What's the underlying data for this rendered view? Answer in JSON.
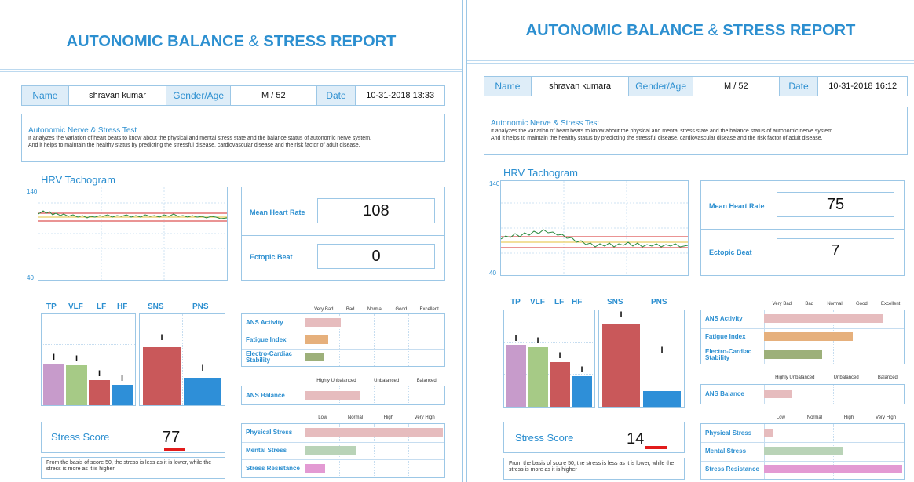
{
  "reports": [
    {
      "title_a": "AUTONOMIC BALANCE",
      "title_amp": "&",
      "title_b": "STRESS REPORT",
      "name_label": "Name",
      "name": "shravan kumar",
      "gender_label": "Gender/Age",
      "gender_age": "M / 52",
      "date_label": "Date",
      "date": "10-31-2018 13:33",
      "test_title": "Autonomic Nerve & Stress Test",
      "test_desc_1": "It analyzes the variation of heart beats to know about the physical and mental stress state and the balance status of autonomic nerve system.",
      "test_desc_2": "And it helps to maintain the healthy status by predicting the stressful disease, cardiovascular disease and the risk factor of adult disease.",
      "hrv_title": "HRV Tachogram",
      "hrv_max": "140",
      "hrv_min": "40",
      "mean_hr_label": "Mean Heart Rate",
      "mean_hr": "108",
      "ectopic_label": "Ectopic Beat",
      "ectopic": "0",
      "bar_labels": [
        "TP",
        "VLF",
        "LF",
        "HF",
        "SNS",
        "PNS"
      ],
      "bar_values": [
        0.46,
        0.44,
        0.28,
        0.22,
        0.64,
        0.3
      ],
      "scale1": [
        "Very Bad",
        "Bad",
        "Normal",
        "Good",
        "Excellent"
      ],
      "ans_activity_label": "ANS Activity",
      "fatigue_label": "Fatigue Index",
      "electro_label": "Electro-Cardiac Stability",
      "ans_activity": 0.26,
      "fatigue": 0.17,
      "electro": 0.14,
      "scale2": [
        "Highly Unbalanced",
        "Unbalanced",
        "Balanced"
      ],
      "ans_balance_label": "ANS Balance",
      "ans_balance": 0.4,
      "scale3": [
        "Low",
        "Normal",
        "High",
        "Very High"
      ],
      "physical_label": "Physical Stress",
      "mental_label": "Mental Stress",
      "resistance_label": "Stress Resistance",
      "physical": 1.0,
      "mental": 0.37,
      "resistance": 0.15,
      "stress_label": "Stress Score",
      "stress_score": "77",
      "note": "From the basis of score 50, the stress is less as it is lower, while the stress is more as it is higher",
      "colors": {
        "tp": "#c79bcb",
        "vlf": "#a6ca86",
        "lf": "#c9585a",
        "hf": "#2e8fd8",
        "sns": "#c9585a",
        "pns": "#2e8fd8",
        "activity": "#e6bcbe",
        "fatigue": "#e6b07c",
        "electro": "#9db07a",
        "balance": "#e6bcbe",
        "physical": "#e6bcbe",
        "mental": "#b9d3b7",
        "resistance": "#e39ad3"
      }
    },
    {
      "title_a": "AUTONOMIC BALANCE",
      "title_amp": "&",
      "title_b": "STRESS REPORT",
      "name_label": "Name",
      "name": "shravan kumara",
      "gender_label": "Gender/Age",
      "gender_age": "M / 52",
      "date_label": "Date",
      "date": "10-31-2018 16:12",
      "test_title": "Autonomic Nerve & Stress Test",
      "test_desc_1": "It analyzes the variation of heart beats to know about the physical and mental stress state and the balance status of autonomic nerve system.",
      "test_desc_2": "And it helps to maintain the healthy status by predicting the stressful disease, cardiovascular disease and the risk factor of adult disease.",
      "hrv_title": "HRV Tachogram",
      "hrv_max": "140",
      "hrv_min": "40",
      "mean_hr_label": "Mean Heart Rate",
      "mean_hr": "75",
      "ectopic_label": "Ectopic Beat",
      "ectopic": "7",
      "bar_labels": [
        "TP",
        "VLF",
        "LF",
        "HF",
        "SNS",
        "PNS"
      ],
      "bar_values": [
        0.64,
        0.62,
        0.46,
        0.32,
        0.85,
        0.16
      ],
      "scale1": [
        "Very Bad",
        "Bad",
        "Normal",
        "Good",
        "Excellent"
      ],
      "ans_activity_label": "ANS Activity",
      "fatigue_label": "Fatigue Index",
      "electro_label": "Electro-Cardiac Stability",
      "ans_activity": 0.86,
      "fatigue": 0.64,
      "electro": 0.42,
      "scale2": [
        "Highly Unbalanced",
        "Unbalanced",
        "Balanced"
      ],
      "ans_balance_label": "ANS Balance",
      "ans_balance": 0.2,
      "scale3": [
        "Low",
        "Normal",
        "High",
        "Very High"
      ],
      "physical_label": "Physical Stress",
      "mental_label": "Mental Stress",
      "resistance_label": "Stress Resistance",
      "physical": 0.07,
      "mental": 0.57,
      "resistance": 1.0,
      "stress_label": "Stress Score",
      "stress_score": "14",
      "note": "From the basis of score 50, the stress is less as it is lower, while the stress is more as it is higher",
      "colors": {
        "tp": "#c79bcb",
        "vlf": "#a6ca86",
        "lf": "#c9585a",
        "hf": "#2e8fd8",
        "sns": "#c9585a",
        "pns": "#2e8fd8",
        "activity": "#e6bcbe",
        "fatigue": "#e6b07c",
        "electro": "#9db07a",
        "balance": "#e6bcbe",
        "physical": "#e6bcbe",
        "mental": "#b9d3b7",
        "resistance": "#e39ad3"
      }
    }
  ]
}
